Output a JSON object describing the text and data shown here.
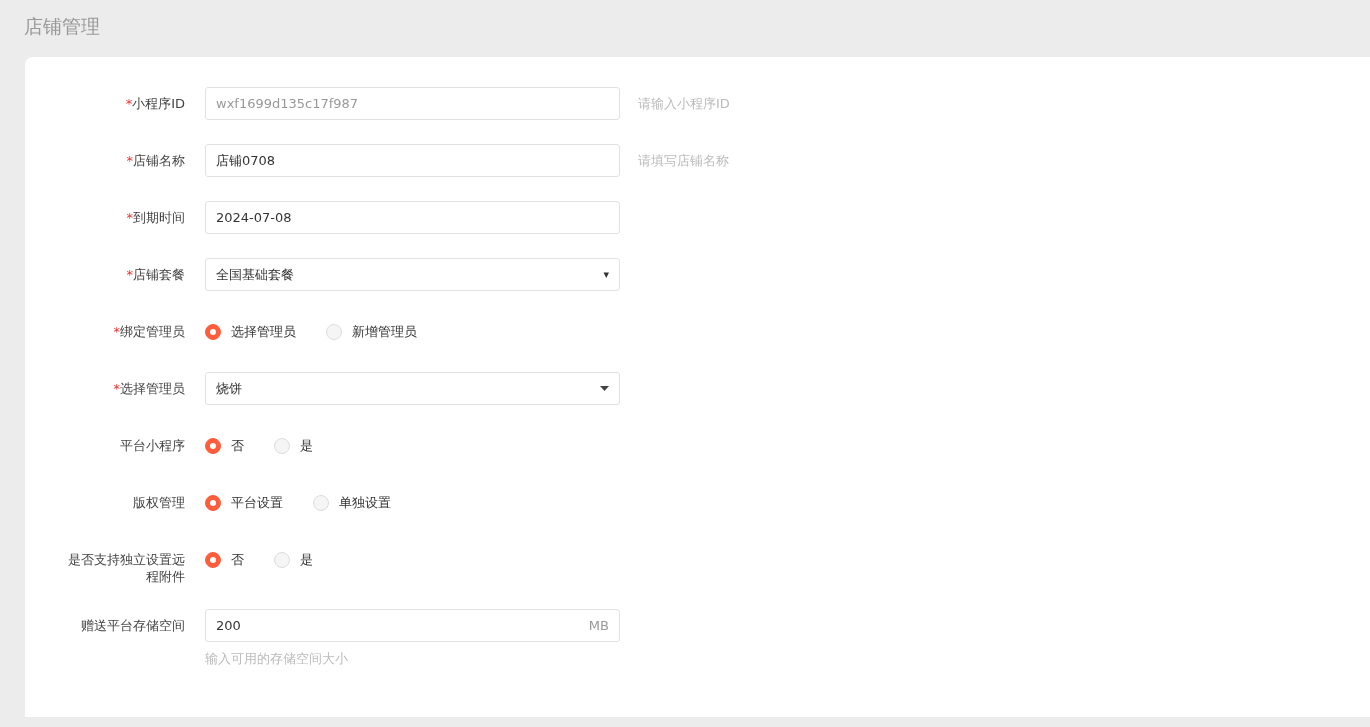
{
  "page_title": "店铺管理",
  "fields": [
    {
      "kind": "text",
      "mark": "*",
      "label": "小程序ID",
      "value": "wxf1699d135c17f987",
      "disabled": true,
      "note": "请输入小程序ID"
    },
    {
      "kind": "text",
      "mark": "*",
      "label": "店铺名称",
      "value": "店铺0708",
      "disabled": false,
      "note": "请填写店铺名称"
    },
    {
      "kind": "text",
      "mark": "*",
      "label": "到期时间",
      "value": "2024-07-08",
      "disabled": false
    },
    {
      "kind": "select",
      "mark": "*",
      "label": "店铺套餐",
      "value": "全国基础套餐",
      "arrow": "▾"
    },
    {
      "kind": "radio",
      "mark": "*",
      "label": "绑定管理员",
      "options": [
        {
          "label": "选择管理员",
          "selected": true
        },
        {
          "label": "新增管理员",
          "selected": false
        }
      ]
    },
    {
      "kind": "select",
      "mark": "*",
      "label": "选择管理员",
      "value": "烧饼"
    },
    {
      "kind": "radio",
      "label": "平台小程序",
      "options": [
        {
          "label": "否",
          "selected": true
        },
        {
          "label": "是",
          "selected": false
        }
      ]
    },
    {
      "kind": "radio",
      "label": "版权管理",
      "options": [
        {
          "label": "平台设置",
          "selected": true
        },
        {
          "label": "单独设置",
          "selected": false
        }
      ]
    },
    {
      "kind": "radio",
      "label": "是否支持独立设置远程附件",
      "options": [
        {
          "label": "否",
          "selected": true
        },
        {
          "label": "是",
          "selected": false
        }
      ]
    },
    {
      "kind": "suffix",
      "label": "赠送平台存储空间",
      "value": "200",
      "disabled": false,
      "suffix": "MB",
      "help": "输入可用的存储空间大小"
    }
  ]
}
